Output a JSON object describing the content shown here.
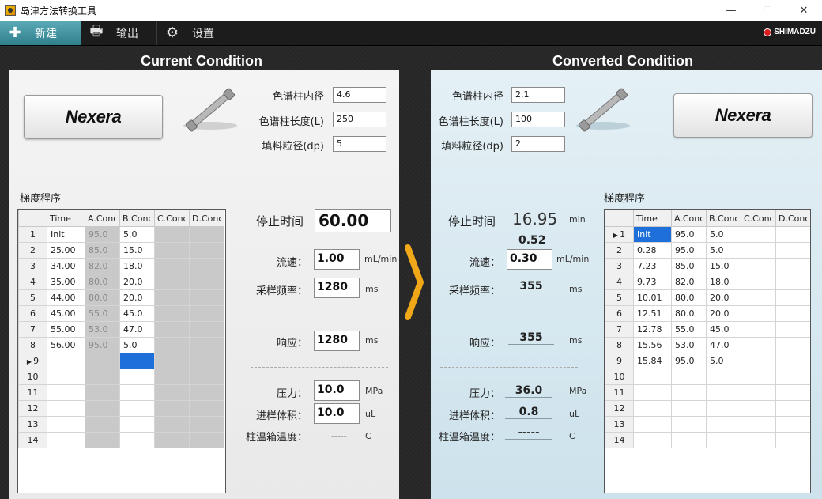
{
  "window": {
    "title": "岛津方法转换工具"
  },
  "toolbar": {
    "new_label": "新建",
    "output_label": "输出",
    "settings_label": "设置",
    "brand": "SHIMADZU"
  },
  "left": {
    "title": "Current Condition",
    "logo": "Nexera",
    "column_id_label": "色谱柱内径",
    "column_id": "4.6",
    "column_len_label": "色谱柱长度(L)",
    "column_len": "250",
    "particle_label": "填料粒径(dp)",
    "particle": "5",
    "gradient_label": "梯度程序",
    "stop_time_label": "停止时间",
    "stop_time": "60.00",
    "flow_label": "流速：",
    "flow": "1.00",
    "flow_unit": "mL/min",
    "sampling_label": "采样频率：",
    "sampling": "1280",
    "sampling_unit": "ms",
    "response_label": "响应：",
    "response": "1280",
    "response_unit": "ms",
    "pressure_label": "压力：",
    "pressure": "10.0",
    "pressure_unit": "MPa",
    "injection_label": "进样体积：",
    "injection": "10.0",
    "injection_unit": "uL",
    "oven_label": "柱温箱温度：",
    "oven": "-----",
    "oven_unit": "C",
    "columns": [
      "",
      "Time",
      "A.Conc",
      "B.Conc",
      "C.Conc",
      "D.Conc"
    ],
    "rows": [
      {
        "n": "1",
        "time": "Init",
        "a": "95.0",
        "b": "5.0"
      },
      {
        "n": "2",
        "time": "25.00",
        "a": "85.0",
        "b": "15.0"
      },
      {
        "n": "3",
        "time": "34.00",
        "a": "82.0",
        "b": "18.0"
      },
      {
        "n": "4",
        "time": "35.00",
        "a": "80.0",
        "b": "20.0"
      },
      {
        "n": "5",
        "time": "44.00",
        "a": "80.0",
        "b": "20.0"
      },
      {
        "n": "6",
        "time": "45.00",
        "a": "55.0",
        "b": "45.0"
      },
      {
        "n": "7",
        "time": "55.00",
        "a": "53.0",
        "b": "47.0"
      },
      {
        "n": "8",
        "time": "56.00",
        "a": "95.0",
        "b": "5.0"
      },
      {
        "n": "9",
        "time": "",
        "a": "",
        "b": "",
        "current": true,
        "sel": "b"
      },
      {
        "n": "10",
        "time": "",
        "a": "",
        "b": ""
      },
      {
        "n": "11",
        "time": "",
        "a": "",
        "b": ""
      },
      {
        "n": "12",
        "time": "",
        "a": "",
        "b": ""
      },
      {
        "n": "13",
        "time": "",
        "a": "",
        "b": ""
      },
      {
        "n": "14",
        "time": "",
        "a": "",
        "b": ""
      }
    ]
  },
  "right": {
    "title": "Converted Condition",
    "logo": "Nexera",
    "column_id_label": "色谱柱内径",
    "column_id": "2.1",
    "column_len_label": "色谱柱长度(L)",
    "column_len": "100",
    "particle_label": "填料粒径(dp)",
    "particle": "2",
    "gradient_label": "梯度程序",
    "stop_time_label": "停止时间",
    "stop_time": "16.95",
    "stop_time_unit": "min",
    "flow_calc": "0.52",
    "flow_label": "流速：",
    "flow": "0.30",
    "flow_unit": "mL/min",
    "sampling_label": "采样频率：",
    "sampling": "355",
    "sampling_unit": "ms",
    "response_label": "响应：",
    "response": "355",
    "response_unit": "ms",
    "pressure_label": "压力：",
    "pressure": "36.0",
    "pressure_unit": "MPa",
    "injection_label": "进样体积：",
    "injection": "0.8",
    "injection_unit": "uL",
    "oven_label": "柱温箱温度：",
    "oven": "-----",
    "oven_unit": "C",
    "columns": [
      "",
      "Time",
      "A.Conc",
      "B.Conc",
      "C.Conc",
      "D.Conc"
    ],
    "rows": [
      {
        "n": "1",
        "time": "Init",
        "a": "95.0",
        "b": "5.0",
        "current": true,
        "sel": "time"
      },
      {
        "n": "2",
        "time": "0.28",
        "a": "95.0",
        "b": "5.0"
      },
      {
        "n": "3",
        "time": "7.23",
        "a": "85.0",
        "b": "15.0"
      },
      {
        "n": "4",
        "time": "9.73",
        "a": "82.0",
        "b": "18.0"
      },
      {
        "n": "5",
        "time": "10.01",
        "a": "80.0",
        "b": "20.0"
      },
      {
        "n": "6",
        "time": "12.51",
        "a": "80.0",
        "b": "20.0"
      },
      {
        "n": "7",
        "time": "12.78",
        "a": "55.0",
        "b": "45.0"
      },
      {
        "n": "8",
        "time": "15.56",
        "a": "53.0",
        "b": "47.0"
      },
      {
        "n": "9",
        "time": "15.84",
        "a": "95.0",
        "b": "5.0"
      },
      {
        "n": "10",
        "time": "",
        "a": "",
        "b": ""
      },
      {
        "n": "11",
        "time": "",
        "a": "",
        "b": ""
      },
      {
        "n": "12",
        "time": "",
        "a": "",
        "b": ""
      },
      {
        "n": "13",
        "time": "",
        "a": "",
        "b": ""
      },
      {
        "n": "14",
        "time": "",
        "a": "",
        "b": ""
      }
    ]
  },
  "colors": {
    "accent": "#f0a818",
    "selection": "#1e6fd9",
    "toolbar_active": "#3f8f9c"
  }
}
